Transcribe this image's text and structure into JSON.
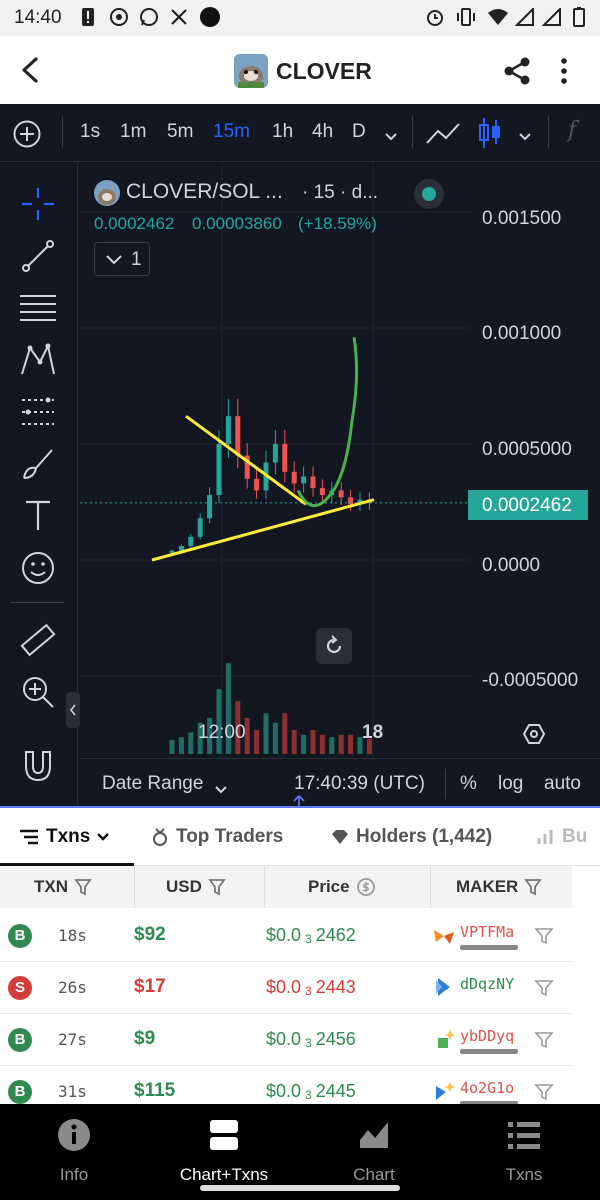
{
  "status_bar": {
    "time": "14:40"
  },
  "header": {
    "title": "CLOVER"
  },
  "toolbar": {
    "timeframes": [
      "1s",
      "1m",
      "5m",
      "15m",
      "1h",
      "4h",
      "D"
    ],
    "active_timeframe": "15m",
    "formula_label": "f"
  },
  "chart": {
    "symbol_title": "CLOVER/SOL ...",
    "interval_text": "· 15 · d...",
    "last_price": "0.0002462",
    "change_abs": "0.00003860",
    "change_pct": "(+18.59%)",
    "indicator_count": "1",
    "price_axis": [
      "0.001500",
      "0.001000",
      "0.0005000",
      "0.0000",
      "-0.0005000"
    ],
    "current_price_tag": "0.0002462",
    "time_axis": [
      "12:00",
      "18"
    ],
    "date_range_label": "Date Range",
    "clock": "17:40:39 (UTC)",
    "scale_options": [
      "%",
      "log",
      "auto"
    ],
    "colors": {
      "up": "#26a69a",
      "down": "#ef5350",
      "trend": "#ffeb3b",
      "projection": "#4caf50",
      "accent": "#2962ff",
      "bg": "#131722"
    }
  },
  "chart_data": {
    "type": "line",
    "title": "CLOVER/SOL · 15",
    "xlabel": "",
    "ylabel": "",
    "ylim": [
      -0.0005,
      0.0015
    ],
    "x_ticks": [
      "12:00",
      "18"
    ],
    "y_ticks": [
      0.0015,
      0.001,
      0.0005,
      0.0,
      -0.0005
    ],
    "series": [
      {
        "name": "",
        "values": [
          4e-05,
          6e-05,
          0.0001,
          0.00018,
          0.00028,
          0.0005,
          0.00062,
          0.00045,
          0.00035,
          0.0003,
          0.00042,
          0.0005,
          0.00038,
          0.00033,
          0.00036,
          0.00031,
          0.00028,
          0.0003,
          0.00027,
          0.00024,
          0.00026,
          0.0002462
        ]
      }
    ],
    "last_value": 0.0002462,
    "grid": true
  },
  "tabs": {
    "items": [
      {
        "label": "Txns"
      },
      {
        "label": "Top Traders"
      },
      {
        "label": "Holders (1,442)"
      },
      {
        "label": "Bu"
      }
    ]
  },
  "table": {
    "columns": [
      "TXN",
      "USD",
      "Price",
      "MAKER"
    ],
    "rows": [
      {
        "type": "B",
        "age": "18s",
        "usd": "$92",
        "price_pre": "$0.0",
        "price_sub": "3",
        "price_post": "2462",
        "maker": "VPTFMa"
      },
      {
        "type": "S",
        "age": "26s",
        "usd": "$17",
        "price_pre": "$0.0",
        "price_sub": "3",
        "price_post": "2443",
        "maker": "dDqzNY"
      },
      {
        "type": "B",
        "age": "27s",
        "usd": "$9",
        "price_pre": "$0.0",
        "price_sub": "3",
        "price_post": "2456",
        "maker": "ybDDyq"
      },
      {
        "type": "B",
        "age": "31s",
        "usd": "$115",
        "price_pre": "$0.0",
        "price_sub": "3",
        "price_post": "2445",
        "maker": "4o2G1o"
      }
    ]
  },
  "bottom_nav": {
    "items": [
      {
        "label": "Info"
      },
      {
        "label": "Chart+Txns"
      },
      {
        "label": "Chart"
      },
      {
        "label": "Txns"
      }
    ],
    "active": "Chart+Txns"
  }
}
